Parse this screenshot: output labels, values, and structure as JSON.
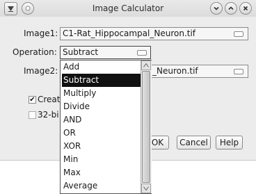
{
  "window": {
    "title": "Image Calculator"
  },
  "form": {
    "image1_label": "Image1:",
    "image1_value": "C1-Rat_Hippocampal_Neuron.tif",
    "operation_label": "Operation:",
    "operation_value": "Subtract",
    "image2_label": "Image2:",
    "image2_value_visible": "_Neuron.tif",
    "create_label_visible": "Create",
    "create_checked": true,
    "bit32_label_visible": "32-bi",
    "bit32_checked": false
  },
  "buttons": {
    "ok": "OK",
    "cancel": "Cancel",
    "help": "Help"
  },
  "operation_options": [
    "Add",
    "Subtract",
    "Multiply",
    "Divide",
    "AND",
    "OR",
    "XOR",
    "Min",
    "Max",
    "Average"
  ],
  "selected_option": "Subtract",
  "icons": {
    "checkmark": "✔",
    "scroll_up": "up-arrow",
    "scroll_down": "down-arrow"
  }
}
